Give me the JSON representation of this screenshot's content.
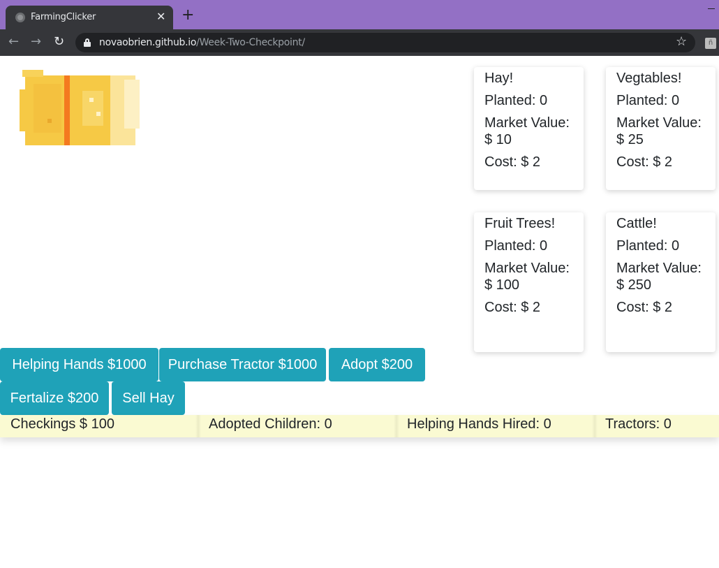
{
  "browser": {
    "tab_title": "FarmingClicker",
    "url_host": "novaobrien.github.io",
    "url_path": "/Week-Two-Checkpoint/"
  },
  "icons": {
    "favicon": "globe-icon",
    "close": "close-icon",
    "new_tab": "plus-icon",
    "back": "back-arrow-icon",
    "forward": "forward-arrow-icon",
    "reload": "reload-icon",
    "lock": "lock-icon",
    "bookmark": "star-icon",
    "extension": "extension-icon",
    "hay": "hay-bale-icon"
  },
  "crops": [
    {
      "name": "Hay!",
      "planted_label": "Planted: 0",
      "market_label": "Market Value: $ 10",
      "cost_label": "Cost: $ 2"
    },
    {
      "name": "Vegtables!",
      "planted_label": "Planted: 0",
      "market_label": "Market Value: $ 25",
      "cost_label": "Cost: $ 2"
    },
    {
      "name": "Fruit Trees!",
      "planted_label": "Planted: 0",
      "market_label": "Market Value: $ 100",
      "cost_label": "Cost: $ 2"
    },
    {
      "name": "Cattle!",
      "planted_label": "Planted: 0",
      "market_label": "Market Value: $ 250",
      "cost_label": "Cost: $ 2"
    }
  ],
  "actions": {
    "helping_hands": "Helping Hands $1000",
    "tractor": "Purchase Tractor $1000",
    "adopt": "Adopt $200",
    "fertalize": "Fertalize $200",
    "sell_hay": "Sell Hay"
  },
  "status": {
    "checkings": "Checkings $ 100",
    "adopted": "Adopted Children: 0",
    "helping_hands": "Helping Hands Hired: 0",
    "tractors": "Tractors: 0"
  },
  "colors": {
    "accent": "#1fa2b8",
    "status_bar": "#fafad2",
    "tab_strip": "#9370c5",
    "hay": "#f5c542"
  }
}
